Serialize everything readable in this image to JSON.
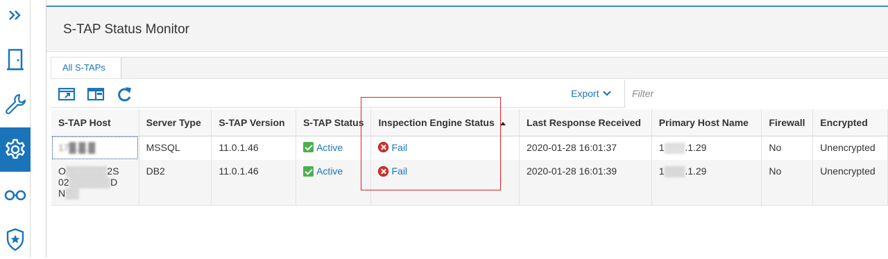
{
  "sidebar": {
    "items": [
      {
        "name": "expand",
        "icon": "double-chevron-right-icon",
        "active": false
      },
      {
        "name": "exit",
        "icon": "door-icon",
        "active": false
      },
      {
        "name": "tools",
        "icon": "wrench-icon",
        "active": false
      },
      {
        "name": "settings",
        "icon": "gear-icon",
        "active": true
      },
      {
        "name": "investigate",
        "icon": "glasses-icon",
        "active": false
      },
      {
        "name": "protect",
        "icon": "shield-star-icon",
        "active": false
      }
    ],
    "accent": "#1b74ba"
  },
  "header": {
    "title": "S-TAP Status Monitor"
  },
  "breadcrumb": {
    "items": [
      "All S-TAPs"
    ]
  },
  "toolbar": {
    "icons": [
      "open-window-icon",
      "column-layout-icon",
      "refresh-icon"
    ],
    "export_label": "Export",
    "filter_placeholder": "Filter"
  },
  "table": {
    "columns": [
      "S-TAP Host",
      "Server Type",
      "S-TAP Version",
      "S-TAP Status",
      "Inspection Engine Status",
      "Last Response Received",
      "Primary Host Name",
      "Firewall",
      "Encrypted"
    ],
    "sorted_column": "Inspection Engine Status",
    "sort_direction": "asc",
    "rows": [
      {
        "host": "17█.█.█",
        "server_type": "MSSQL",
        "version": "11.0.1.46",
        "status": "Active",
        "engine_status": "Fail",
        "last_response": "2020-01-28 16:01:37",
        "primary_host_suffix": ".1.29",
        "firewall": "No",
        "encrypted": "Unencrypted"
      },
      {
        "host_line1_prefix": "O",
        "host_line1_suffix": "2S",
        "host_line2_prefix": "02",
        "host_line2_suffix": "D",
        "host_line3_prefix": "N",
        "server_type": "DB2",
        "version": "11.0.1.46",
        "status": "Active",
        "engine_status": "Fail",
        "last_response": "2020-01-28 16:01:39",
        "primary_host_suffix": ".1.29",
        "firewall": "No",
        "encrypted": "Unencrypted"
      }
    ]
  },
  "colors": {
    "active": "#4caf50",
    "fail": "#d9312d",
    "highlight": "#e02020",
    "link": "#1b74ba"
  }
}
